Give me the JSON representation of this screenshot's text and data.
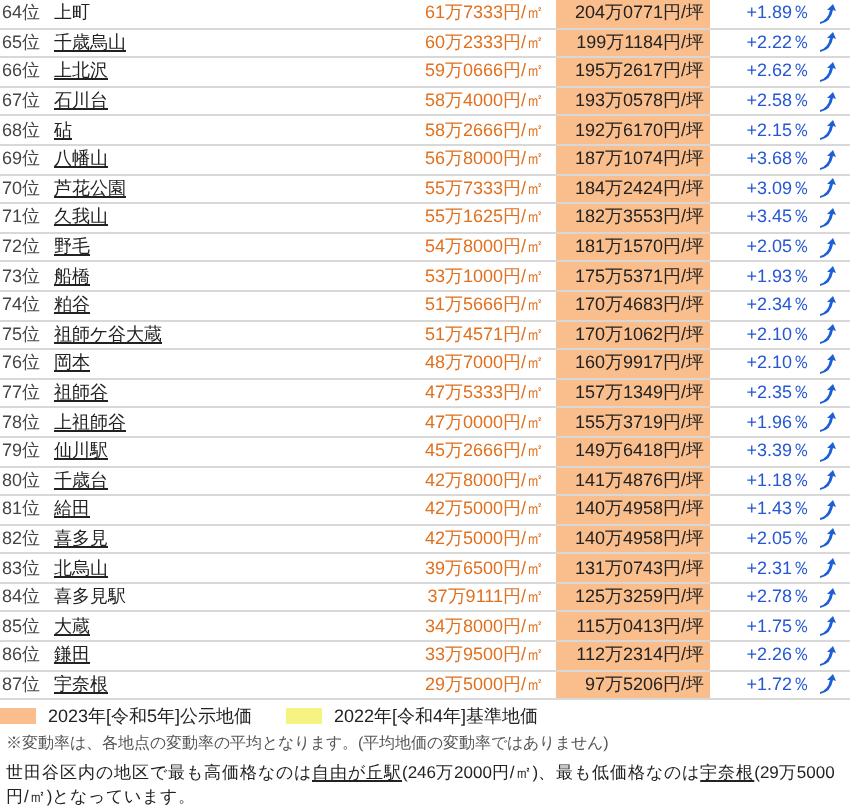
{
  "rows": [
    {
      "rank": "64位",
      "name": "上町",
      "linked": false,
      "price_m2": "61万7333円/㎡",
      "price_tsubo": "204万0771円/坪",
      "change": "+1.89％"
    },
    {
      "rank": "65位",
      "name": "千歳烏山",
      "linked": true,
      "price_m2": "60万2333円/㎡",
      "price_tsubo": "199万1184円/坪",
      "change": "+2.22％"
    },
    {
      "rank": "66位",
      "name": "上北沢",
      "linked": true,
      "price_m2": "59万0666円/㎡",
      "price_tsubo": "195万2617円/坪",
      "change": "+2.62％"
    },
    {
      "rank": "67位",
      "name": "石川台",
      "linked": true,
      "price_m2": "58万4000円/㎡",
      "price_tsubo": "193万0578円/坪",
      "change": "+2.58％"
    },
    {
      "rank": "68位",
      "name": "砧",
      "linked": true,
      "price_m2": "58万2666円/㎡",
      "price_tsubo": "192万6170円/坪",
      "change": "+2.15％"
    },
    {
      "rank": "69位",
      "name": "八幡山",
      "linked": true,
      "price_m2": "56万8000円/㎡",
      "price_tsubo": "187万1074円/坪",
      "change": "+3.68％"
    },
    {
      "rank": "70位",
      "name": "芦花公園",
      "linked": true,
      "price_m2": "55万7333円/㎡",
      "price_tsubo": "184万2424円/坪",
      "change": "+3.09％"
    },
    {
      "rank": "71位",
      "name": "久我山",
      "linked": true,
      "price_m2": "55万1625円/㎡",
      "price_tsubo": "182万3553円/坪",
      "change": "+3.45％"
    },
    {
      "rank": "72位",
      "name": "野毛",
      "linked": true,
      "price_m2": "54万8000円/㎡",
      "price_tsubo": "181万1570円/坪",
      "change": "+2.05％"
    },
    {
      "rank": "73位",
      "name": "船橋",
      "linked": true,
      "price_m2": "53万1000円/㎡",
      "price_tsubo": "175万5371円/坪",
      "change": "+1.93％"
    },
    {
      "rank": "74位",
      "name": "粕谷",
      "linked": true,
      "price_m2": "51万5666円/㎡",
      "price_tsubo": "170万4683円/坪",
      "change": "+2.34％"
    },
    {
      "rank": "75位",
      "name": "祖師ケ谷大蔵",
      "linked": true,
      "price_m2": "51万4571円/㎡",
      "price_tsubo": "170万1062円/坪",
      "change": "+2.10％"
    },
    {
      "rank": "76位",
      "name": "岡本",
      "linked": true,
      "price_m2": "48万7000円/㎡",
      "price_tsubo": "160万9917円/坪",
      "change": "+2.10％"
    },
    {
      "rank": "77位",
      "name": "祖師谷",
      "linked": true,
      "price_m2": "47万5333円/㎡",
      "price_tsubo": "157万1349円/坪",
      "change": "+2.35％"
    },
    {
      "rank": "78位",
      "name": "上祖師谷",
      "linked": true,
      "price_m2": "47万0000円/㎡",
      "price_tsubo": "155万3719円/坪",
      "change": "+1.96％"
    },
    {
      "rank": "79位",
      "name": "仙川駅",
      "linked": true,
      "price_m2": "45万2666円/㎡",
      "price_tsubo": "149万6418円/坪",
      "change": "+3.39％"
    },
    {
      "rank": "80位",
      "name": "千歳台",
      "linked": true,
      "price_m2": "42万8000円/㎡",
      "price_tsubo": "141万4876円/坪",
      "change": "+1.18％"
    },
    {
      "rank": "81位",
      "name": "給田",
      "linked": true,
      "price_m2": "42万5000円/㎡",
      "price_tsubo": "140万4958円/坪",
      "change": "+1.43％"
    },
    {
      "rank": "82位",
      "name": "喜多見",
      "linked": true,
      "price_m2": "42万5000円/㎡",
      "price_tsubo": "140万4958円/坪",
      "change": "+2.05％"
    },
    {
      "rank": "83位",
      "name": "北烏山",
      "linked": true,
      "price_m2": "39万6500円/㎡",
      "price_tsubo": "131万0743円/坪",
      "change": "+2.31％"
    },
    {
      "rank": "84位",
      "name": "喜多見駅",
      "linked": false,
      "price_m2": "37万9111円/㎡",
      "price_tsubo": "125万3259円/坪",
      "change": "+2.78％"
    },
    {
      "rank": "85位",
      "name": "大蔵",
      "linked": true,
      "price_m2": "34万8000円/㎡",
      "price_tsubo": "115万0413円/坪",
      "change": "+1.75％"
    },
    {
      "rank": "86位",
      "name": "鎌田",
      "linked": true,
      "price_m2": "33万9500円/㎡",
      "price_tsubo": "112万2314円/坪",
      "change": "+2.26％"
    },
    {
      "rank": "87位",
      "name": "宇奈根",
      "linked": true,
      "price_m2": "29万5000円/㎡",
      "price_tsubo": "97万5206円/坪",
      "change": "+1.72％"
    }
  ],
  "legend": [
    {
      "label": "2023年[令和5年]公示地価",
      "color": "#f9be8c"
    },
    {
      "label": "2022年[令和4年]基準地価",
      "color": "#f7f382"
    }
  ],
  "note": "※変動率は、各地点の変動率の平均となります。(平均地価の変動率ではありません)",
  "summary": {
    "before": "世田谷区内の地区で最も高価格なのは",
    "highest": "自由が丘駅",
    "middle": "(246万2000円/㎡)、最も低価格なのは",
    "lowest": "宇奈根",
    "after": "(29万5000円/㎡)となっています。"
  }
}
